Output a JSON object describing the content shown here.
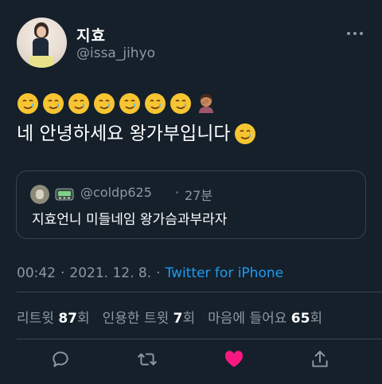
{
  "author": {
    "display_name": "지효",
    "handle": "@issa_jihyo"
  },
  "tweet": {
    "emojis": [
      "smiling-face-with-tear",
      "smiling-face-with-tear",
      "smiling-face-with-tear",
      "smiling-face-with-tear",
      "smiling-face-with-tear",
      "smiling-face-with-tear",
      "smiling-face-with-tear",
      "person-facepalming"
    ],
    "text": "네 안녕하세요 왕가부입니다",
    "trailing_emoji": "smiling-face-with-tear"
  },
  "quote": {
    "handle": "@coldp625",
    "separator": "·",
    "time": "27분",
    "text": "지효언니 미들네임 왕가슴과부라자"
  },
  "meta": {
    "time": "00:42",
    "separator1": "·",
    "date": "2021. 12. 8.",
    "separator2": "·",
    "source": "Twitter for iPhone"
  },
  "stats": {
    "retweets_label": "리트윗",
    "retweets_count": "87",
    "retweets_unit": "회",
    "quotes_label": "인용한 트윗",
    "quotes_count": "7",
    "quotes_unit": "회",
    "likes_label": "마음에 들어요",
    "likes_count": "65",
    "likes_unit": "회"
  },
  "actions": [
    "reply-icon",
    "retweet-icon",
    "like-icon",
    "share-icon"
  ],
  "colors": {
    "background": "#15202b",
    "muted": "#8b98a5",
    "link": "#1d9bf0",
    "border": "#38444d",
    "like": "#f91880"
  }
}
